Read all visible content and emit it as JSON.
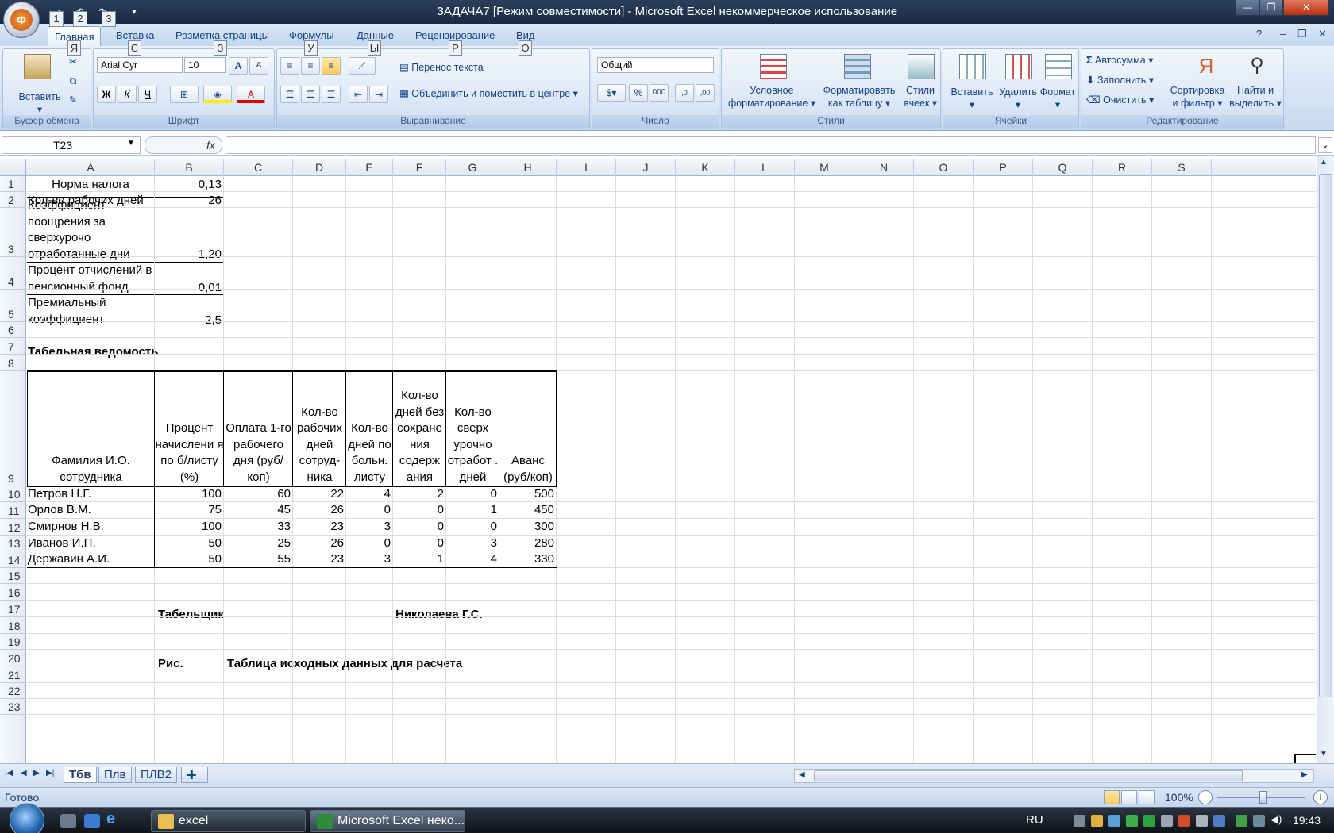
{
  "window": {
    "title": "ЗАДАЧА7  [Режим совместимости] - Microsoft Excel некоммерческое использование",
    "office_button_glyph": "Ф",
    "qat_keytips": [
      "1",
      "2",
      "3"
    ]
  },
  "ribbon": {
    "tabs": [
      {
        "label": "Главная",
        "keytip": "Я"
      },
      {
        "label": "Вставка",
        "keytip": "С"
      },
      {
        "label": "Разметка страницы",
        "keytip": "З"
      },
      {
        "label": "Формулы",
        "keytip": "У"
      },
      {
        "label": "Данные",
        "keytip": "Ы"
      },
      {
        "label": "Рецензирование",
        "keytip": "Р"
      },
      {
        "label": "Вид",
        "keytip": "О"
      }
    ],
    "groups": {
      "clipboard": {
        "label": "Буфер обмена",
        "paste": "Вставить"
      },
      "font": {
        "label": "Шрифт",
        "font_name": "Arial Cyr",
        "font_size": "10",
        "bold": "Ж",
        "italic": "К",
        "underline": "Ч",
        "grow": "A",
        "shrink": "A",
        "fill": "A"
      },
      "alignment": {
        "label": "Выравнивание",
        "wrap_text": "Перенос текста",
        "merge_center": "Объединить и поместить в центре"
      },
      "number": {
        "label": "Число",
        "format": "Общий",
        "percent": "%",
        "thousands": "000",
        "inc_decimal": ",0",
        "dec_decimal": ",00"
      },
      "styles": {
        "label": "Стили",
        "conditional_1": "Условное",
        "conditional_2": "форматирование",
        "as_table_1": "Форматировать",
        "as_table_2": "как таблицу",
        "cell_styles_1": "Стили",
        "cell_styles_2": "ячеек"
      },
      "cells": {
        "label": "Ячейки",
        "insert": "Вставить",
        "delete": "Удалить",
        "format": "Формат"
      },
      "editing": {
        "label": "Редактирование",
        "autosum": "Автосумма",
        "fill": "Заполнить",
        "clear": "Очистить",
        "sort_1": "Сортировка",
        "sort_2": "и фильтр",
        "find_1": "Найти и",
        "find_2": "выделить",
        "sigma": "Σ"
      }
    }
  },
  "formula_bar": {
    "name_box": "T23",
    "fx": "fx",
    "formula": ""
  },
  "sheet": {
    "columns": [
      "A",
      "B",
      "C",
      "D",
      "E",
      "F",
      "G",
      "H",
      "I",
      "J",
      "K",
      "L",
      "M",
      "N",
      "O",
      "P",
      "Q",
      "R",
      "S"
    ],
    "rows": [
      "1",
      "2",
      "3",
      "4",
      "5",
      "6",
      "7",
      "8",
      "9",
      "10",
      "11",
      "12",
      "13",
      "14",
      "15",
      "16",
      "17",
      "18",
      "19",
      "20",
      "21",
      "22",
      "23"
    ],
    "params": [
      {
        "label": "Норма  налога",
        "value": "0,13"
      },
      {
        "label": "Кол-во рабочих дней",
        "value": "26"
      },
      {
        "label": "Коэффициент поощрения за сверхурочо отработанные дни",
        "value": "1,20"
      },
      {
        "label": "Процент отчислений в пенсионный фонд",
        "value": "0,01"
      },
      {
        "label": "Премиальный коэффициент",
        "value": "2,5"
      }
    ],
    "section_title": "Табельная ведомость",
    "table_headers": [
      "Фамилия И.О. сотрудника",
      "Процент начислени я по б/листу (%)",
      "Оплата 1-го рабочего дня (руб/коп)",
      "Кол-во рабочих дней сотруд-ника",
      "Кол-во дней по больн. листу",
      "Кол-во дней без сохране ния содерж ания",
      "Кол-во сверх урочно отработ . дней",
      "Аванс (руб/коп)"
    ],
    "table_rows": [
      [
        "Петров Н.Г.",
        "100",
        "60",
        "22",
        "4",
        "2",
        "0",
        "500"
      ],
      [
        "Орлов В.М.",
        "75",
        "45",
        "26",
        "0",
        "0",
        "1",
        "450"
      ],
      [
        "Смирнов Н.В.",
        "100",
        "33",
        "23",
        "3",
        "0",
        "0",
        "300"
      ],
      [
        "Иванов И.П.",
        "50",
        "25",
        "26",
        "0",
        "0",
        "3",
        "280"
      ],
      [
        "Державин А.И.",
        "50",
        "55",
        "23",
        "3",
        "1",
        "4",
        "330"
      ]
    ],
    "signature_label": "Табельщик",
    "signature_name": "Николаева Г.С.",
    "caption_label": "Рис.",
    "caption_text": "Таблица исходных данных для расчета"
  },
  "sheet_tabs": [
    "Тбв",
    "Плв",
    "ПЛВ2"
  ],
  "status_bar": {
    "status": "Готово",
    "zoom": "100%",
    "zoom_level_percent": 100
  },
  "taskbar": {
    "apps": [
      "excel",
      "Microsoft Excel неко..."
    ],
    "language": "RU",
    "clock": "19:43"
  },
  "colors": {
    "ribbon_text": "#15428b",
    "title_bar": "#1a2a42",
    "grid_line": "#d5dde8"
  }
}
